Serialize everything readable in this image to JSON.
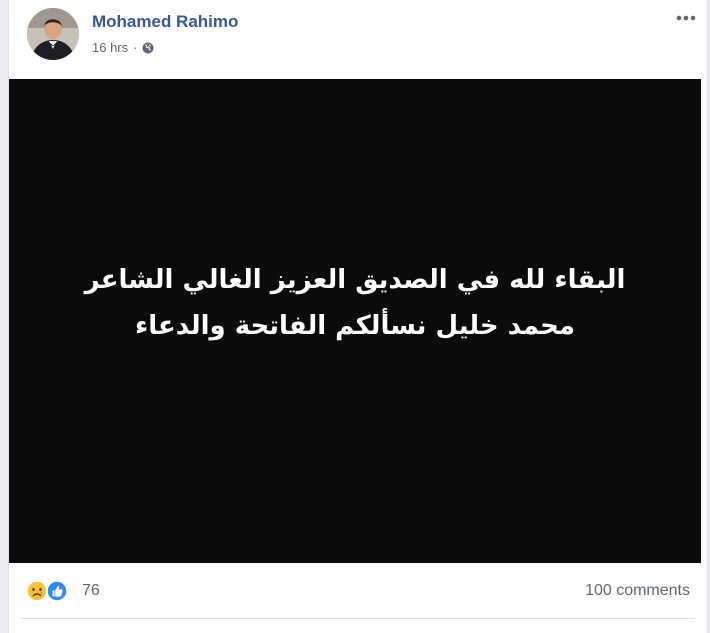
{
  "post": {
    "author": "Mohamed Rahimo",
    "time": "16 hrs",
    "dot": "·",
    "privacy_icon": "globe-icon",
    "menu_icon": "more-icon",
    "image_text": {
      "line1": "البقاء لله في الصديق العزيز الغالي الشاعر",
      "line2": "محمد خليل نسألكم الفاتحة والدعاء"
    }
  },
  "reactions": {
    "count": "76",
    "icons": [
      "sad-reaction-icon",
      "like-reaction-icon"
    ]
  },
  "comments": {
    "label": "100 comments"
  },
  "colors": {
    "name": "#365899",
    "meta": "#606770",
    "media_bg": "#0b0b0b",
    "like_blue": "#2d88ff",
    "sad_yellow": "#f8c136"
  }
}
